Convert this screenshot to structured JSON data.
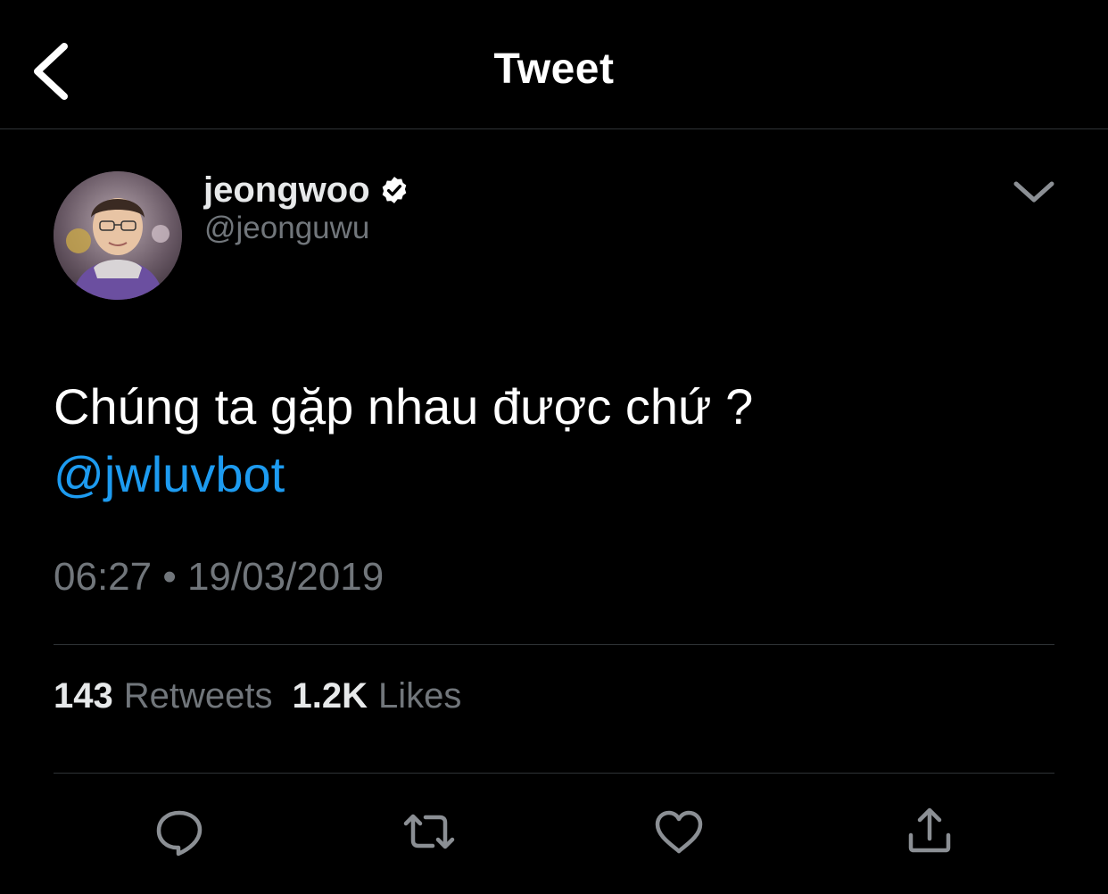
{
  "header": {
    "title": "Tweet",
    "back_icon": "chevron-left-icon"
  },
  "author": {
    "display_name": "jeongwoo",
    "handle": "@jeonguwu",
    "verified": true,
    "verified_icon": "verified-badge-icon"
  },
  "tweet": {
    "text": "Chúng ta gặp nhau được chứ ?",
    "mention": "@jwluvbot",
    "timestamp": "06:27 • 19/03/2019"
  },
  "stats": {
    "retweets_count": "143",
    "retweets_label": "Retweets",
    "likes_count": "1.2K",
    "likes_label": "Likes"
  },
  "actions": [
    "reply-icon",
    "retweet-icon",
    "like-icon",
    "share-icon"
  ],
  "colors": {
    "background": "#000000",
    "text": "#ffffff",
    "secondary": "#71767b",
    "accent": "#1d9bf0",
    "divider": "#2f3336"
  }
}
